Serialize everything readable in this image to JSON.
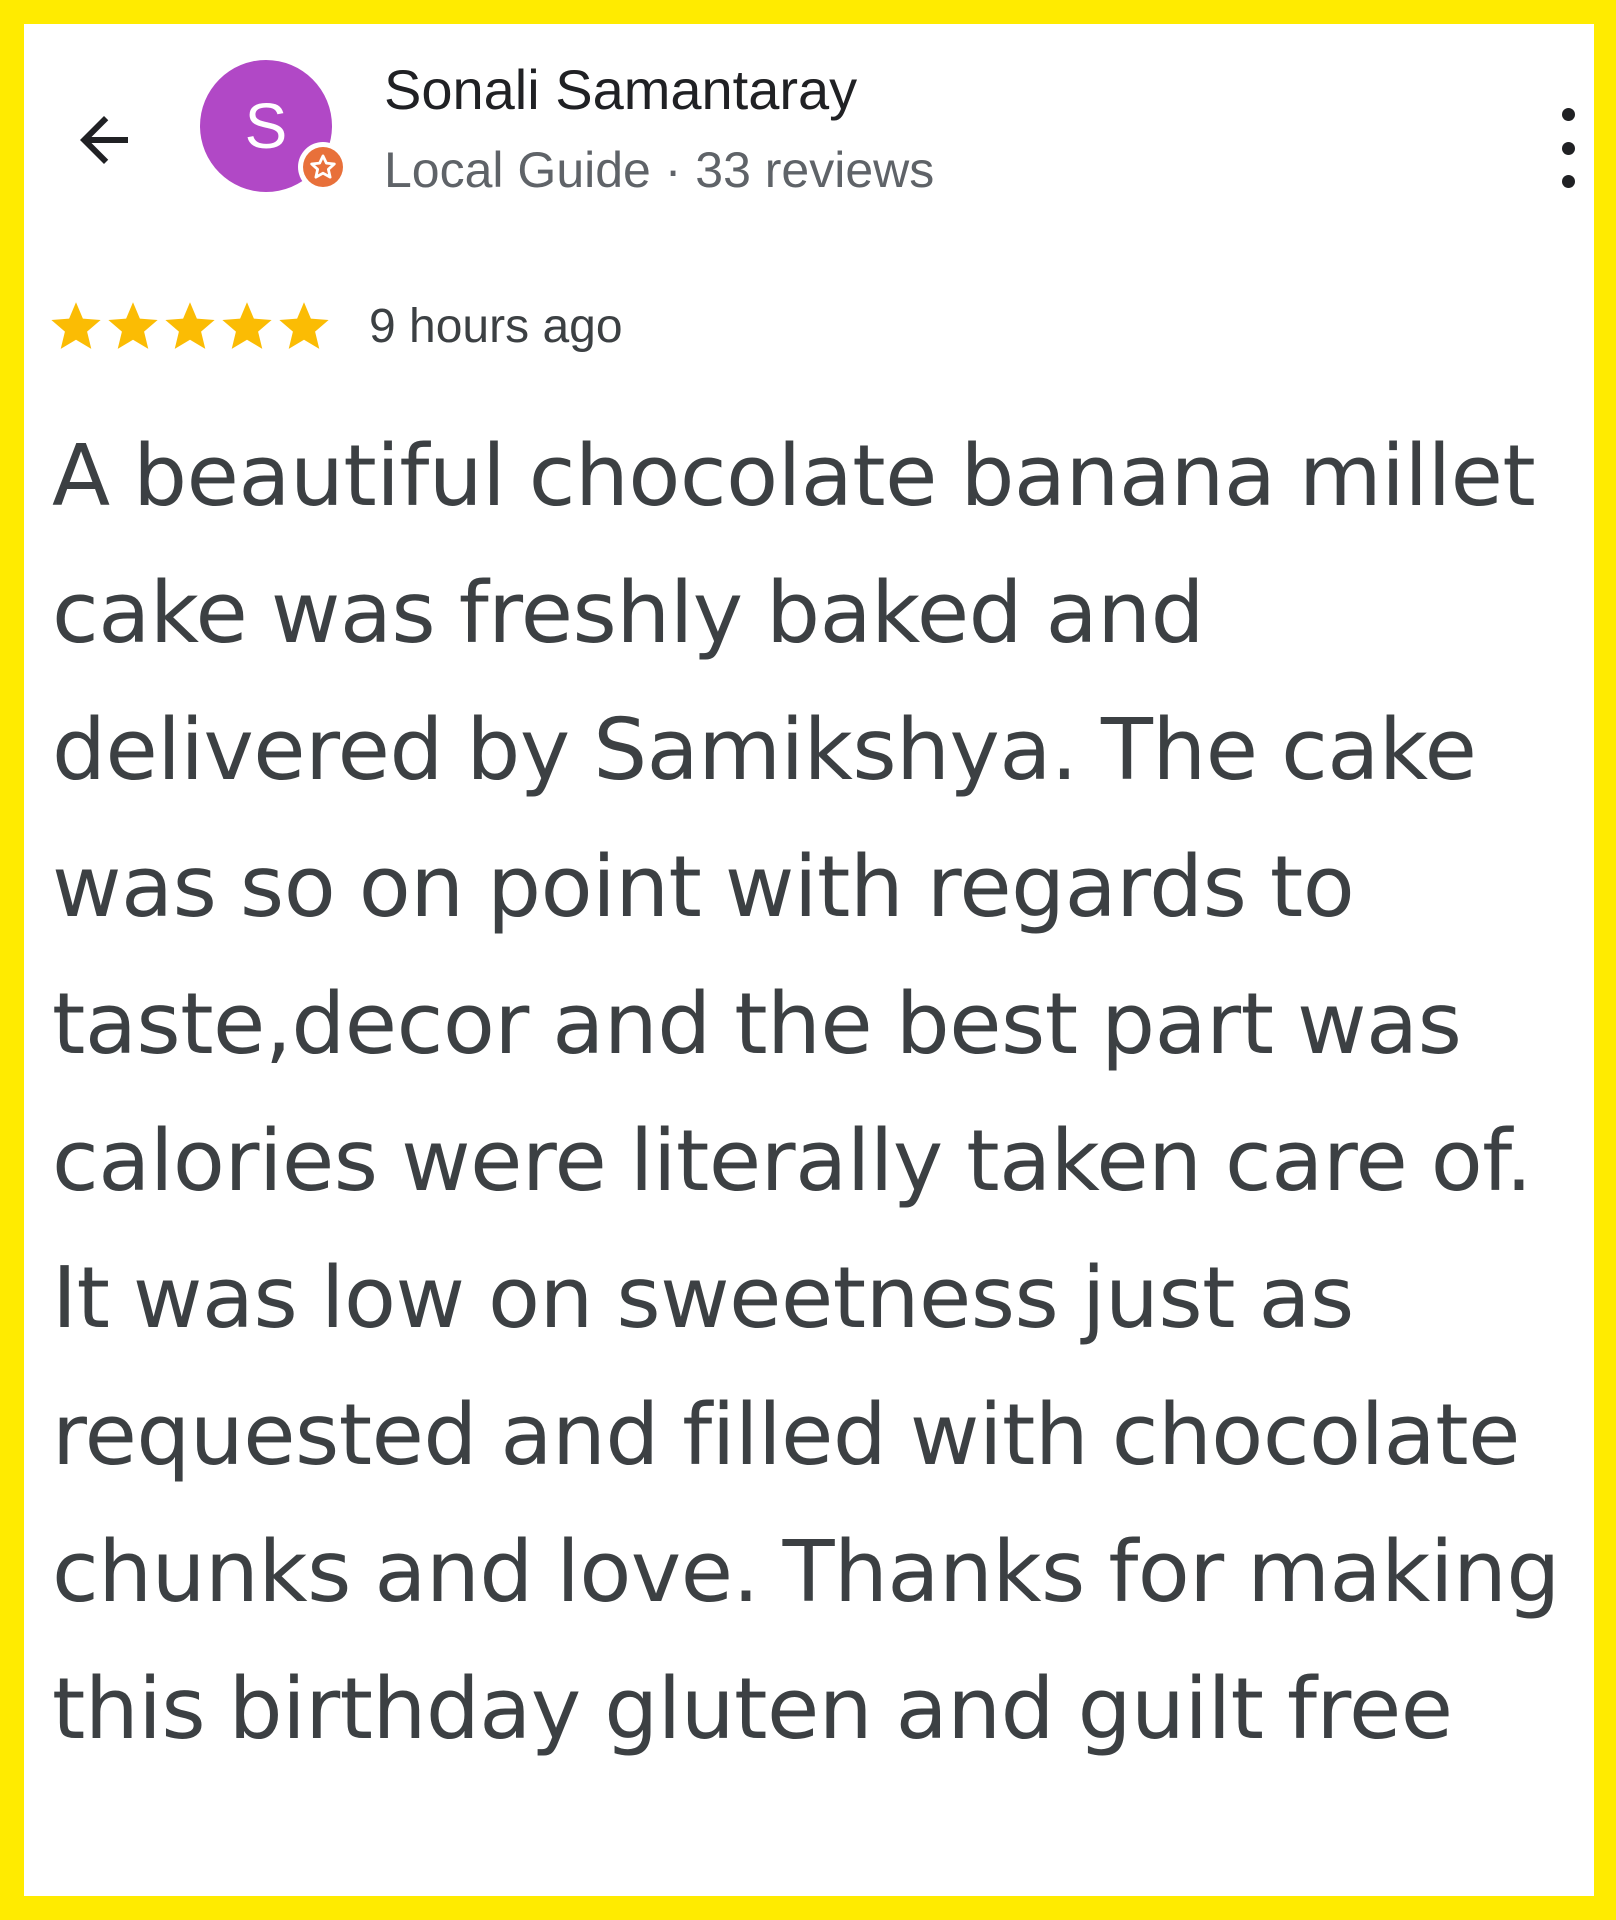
{
  "header": {
    "avatar_letter": "S",
    "reviewer_name": "Sonali Samantaray",
    "reviewer_meta": "Local Guide · 33 reviews"
  },
  "review": {
    "rating": 5,
    "max_rating": 5,
    "time_ago": "9 hours ago",
    "text": "A beautiful chocolate banana millet cake was freshly baked and delivered by Samikshya. The cake was so on point with regards to taste,decor and the best part was calories were literally taken care of. It was low on sweetness just as requested and filled with chocolate chunks and love. Thanks for making this birthday gluten and guilt free"
  },
  "colors": {
    "frame": "#FFEB00",
    "avatar": "#B148C6",
    "badge": "#E8703A",
    "star": "#FBBC04"
  },
  "icons": {
    "back": "arrow-left-icon",
    "menu": "more-vertical-icon",
    "badge": "local-guide-star-icon",
    "rating": "star-icon"
  }
}
